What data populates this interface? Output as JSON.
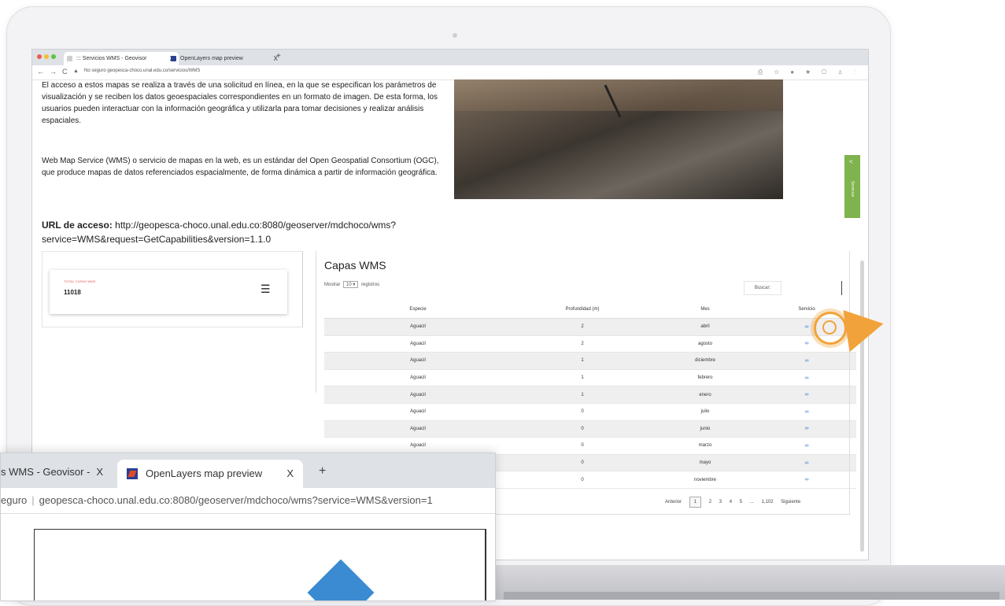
{
  "browser": {
    "tabs": [
      {
        "label": "::: Servicios WMS - Geovisor",
        "close": "X"
      },
      {
        "label": "OpenLayers map preview",
        "close": "X"
      }
    ],
    "new_tab": "+",
    "address": "No seguro   geopesca-choco.unal.edu.co/servicios/WMS",
    "nav": {
      "back": "←",
      "forward": "→",
      "reload": "C"
    },
    "right_icons": "⎙ ☆ ● ★ ▢ ♙ ⋮"
  },
  "content": {
    "paragraph1": "El acceso a estos mapas se realiza a través de una solicitud en línea, en la que se especifican los parámetros de visualización y se reciben los datos geoespaciales correspondientes en un formato de imagen. De esta forma, los usuarios pueden interactuar con la información geográfica y utilizarla para tomar decisiones y realizar análisis espaciales.",
    "paragraph2": "Web Map Service (WMS) o servicio de mapas en la web, es un estándar del Open Geospatial Consortium (OGC), que produce mapas de datos referenciados espacialmente, de forma dinámica a partir de información geográfica.",
    "url_label": "URL de acceso:",
    "url_value": "http://geopesca-choco.unal.edu.co:8080/geoserver/mdchoco/wms?service=WMS&request=GetCapabilities&version=1.1.0"
  },
  "card": {
    "label": "TOTAL CAPAS WMS",
    "value": "11018",
    "icon": "layers-icon"
  },
  "side_tab": {
    "label": "Servicios",
    "chevron": "<"
  },
  "wms_table": {
    "title": "Capas WMS",
    "show_prefix": "Mostrar",
    "show_value": "10",
    "show_suffix": "registros",
    "search_label": "Buscar:",
    "headers": [
      "Especie",
      "Profundidad (m)",
      "Mes",
      "Servicio"
    ],
    "rows": [
      [
        "Aguacil",
        "2",
        "abril",
        "link"
      ],
      [
        "Aguacil",
        "2",
        "agosto",
        "link"
      ],
      [
        "Aguacil",
        "1",
        "diciembre",
        "link"
      ],
      [
        "Aguacil",
        "1",
        "febrero",
        "link"
      ],
      [
        "Aguacil",
        "1",
        "enero",
        "link"
      ],
      [
        "Aguacil",
        "0",
        "julio",
        "link"
      ],
      [
        "Aguacil",
        "0",
        "junio",
        "link"
      ],
      [
        "Aguacil",
        "0",
        "marzo",
        "link"
      ],
      [
        "",
        "0",
        "mayo",
        "link"
      ],
      [
        "",
        "0",
        "noviembre",
        "link"
      ]
    ],
    "pagination": {
      "prev": "Anterior",
      "pages": [
        "1",
        "2",
        "3",
        "4",
        "5",
        "...",
        "1,102"
      ],
      "next": "Siguiente"
    }
  },
  "popup": {
    "tab1": "s WMS - Geovisor -",
    "tab1_close": "X",
    "tab2": "OpenLayers map preview",
    "tab2_close": "X",
    "new_tab": "+",
    "address_prefix": "eguro",
    "address": "geopesca-choco.unal.edu.co:8080/geoserver/mdchoco/wms?service=WMS&version=1"
  },
  "colors": {
    "accent_orange": "#f2a23a",
    "side_tab_green": "#7fb34d",
    "link_blue": "#3c7ad6",
    "map_blue": "#3a8bd1"
  }
}
